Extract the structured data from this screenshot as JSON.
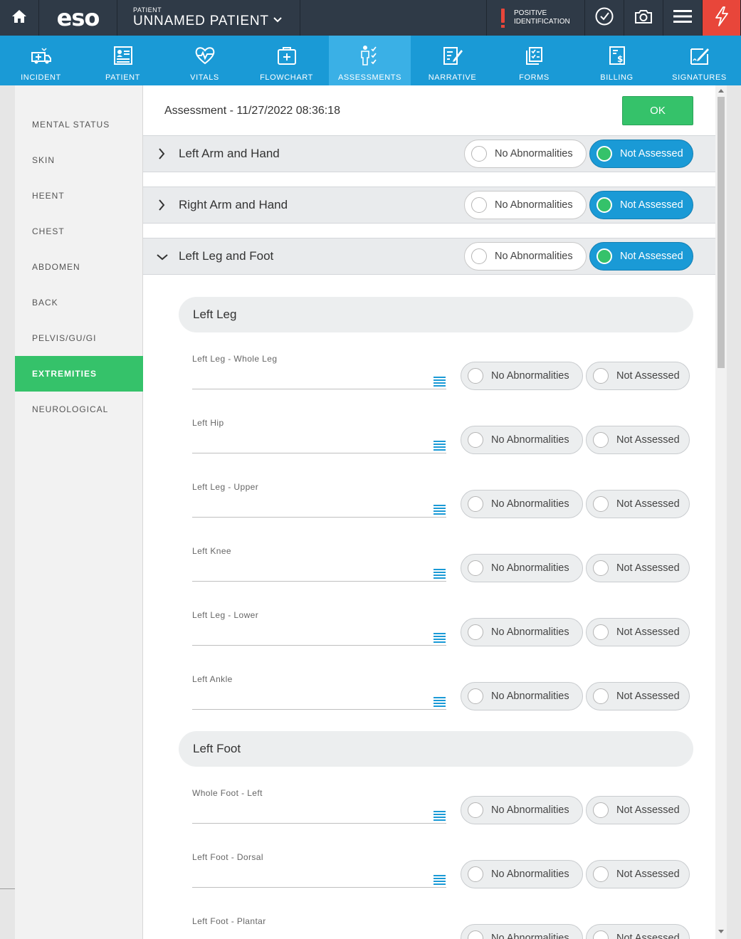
{
  "topbar": {
    "logo": "eso",
    "patient_label": "PATIENT",
    "patient_name": "UNNAMED PATIENT",
    "positive_id_line1": "POSITIVE",
    "positive_id_line2": "IDENTIFICATION",
    "icons": [
      "home-icon",
      "chevron-down-icon",
      "exclamation-icon",
      "check-circle-icon",
      "camera-icon",
      "hamburger-menu-icon",
      "flash-icon"
    ]
  },
  "nav": {
    "items": [
      {
        "label": "INCIDENT",
        "icon": "ambulance-icon"
      },
      {
        "label": "PATIENT",
        "icon": "patient-card-icon"
      },
      {
        "label": "VITALS",
        "icon": "heart-pulse-icon"
      },
      {
        "label": "FLOWCHART",
        "icon": "medkit-icon"
      },
      {
        "label": "ASSESSMENTS",
        "icon": "body-check-icon",
        "active": true
      },
      {
        "label": "NARRATIVE",
        "icon": "pencil-document-icon"
      },
      {
        "label": "FORMS",
        "icon": "checklist-icon"
      },
      {
        "label": "BILLING",
        "icon": "billing-document-icon"
      },
      {
        "label": "SIGNATURES",
        "icon": "signature-icon"
      }
    ]
  },
  "sidebar": {
    "items": [
      {
        "label": "MENTAL STATUS"
      },
      {
        "label": "SKIN"
      },
      {
        "label": "HEENT"
      },
      {
        "label": "CHEST"
      },
      {
        "label": "ABDOMEN"
      },
      {
        "label": "BACK"
      },
      {
        "label": "PELVIS/GU/GI"
      },
      {
        "label": "EXTREMITIES",
        "active": true
      },
      {
        "label": "NEUROLOGICAL"
      }
    ]
  },
  "main": {
    "title": "Assessment - 11/27/2022 08:36:18",
    "ok_label": "OK",
    "option_no_abn": "No Abnormalities",
    "option_not_assessed": "Not Assessed",
    "sections": [
      {
        "title": "Left Arm and Hand",
        "expanded": false,
        "selected": "Not Assessed"
      },
      {
        "title": "Right Arm and Hand",
        "expanded": false,
        "selected": "Not Assessed"
      },
      {
        "title": "Left Leg and Foot",
        "expanded": true,
        "selected": "Not Assessed"
      }
    ],
    "subsections": [
      {
        "title": "Left Leg",
        "fields": [
          "Left Leg - Whole Leg",
          "Left Hip",
          "Left Leg - Upper",
          "Left Knee",
          "Left Leg - Lower",
          "Left Ankle"
        ]
      },
      {
        "title": "Left Foot",
        "fields": [
          "Whole Foot - Left",
          "Left Foot - Dorsal",
          "Left Foot - Plantar"
        ]
      }
    ]
  },
  "colors": {
    "topbar": "#2f3a47",
    "nav": "#1a9ad6",
    "nav_active": "#3ab0e6",
    "accent_green": "#35c26a",
    "alert_red": "#e8463a"
  }
}
